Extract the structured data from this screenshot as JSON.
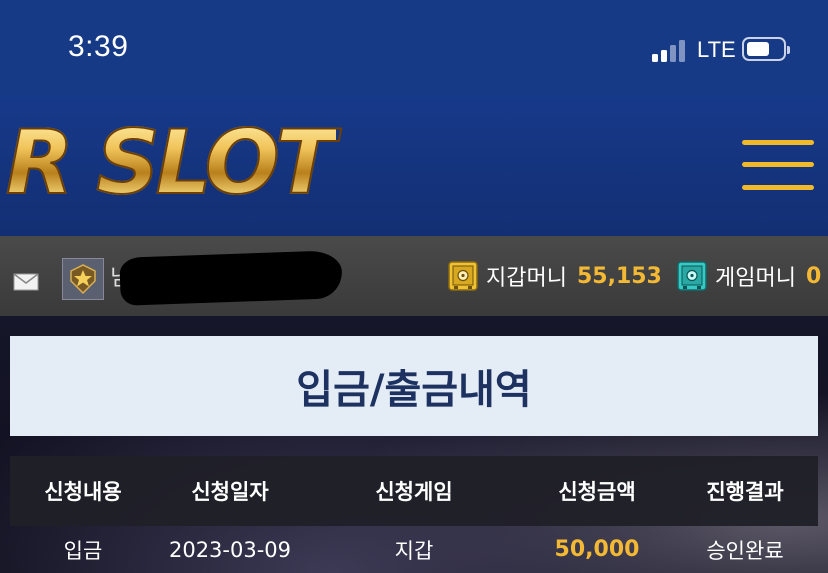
{
  "status_bar": {
    "time": "3:39",
    "network": "LTE",
    "signal_icon": "cellular-signal-icon",
    "battery_icon": "battery-icon"
  },
  "header": {
    "logo_text": "R SLOT",
    "menu_icon": "hamburger-menu-icon",
    "accent_color": "#f1b92a"
  },
  "user_bar": {
    "mail_icon": "envelope-icon",
    "rank_icon": "star-rank-badge-icon",
    "username_partial": "님",
    "wallet": {
      "label": "지갑머니",
      "amount": "55,153",
      "icon": "safe-icon"
    },
    "game_money": {
      "label": "게임머니",
      "amount": "0",
      "icon": "safe-icon"
    }
  },
  "page": {
    "title": "입금/출금내역"
  },
  "table": {
    "headers": [
      "신청내용",
      "신청일자",
      "신청게임",
      "신청금액",
      "진행결과"
    ],
    "rows": [
      [
        "입금",
        "2023-03-09",
        "지갑",
        "50,000",
        "승인완료"
      ]
    ]
  }
}
